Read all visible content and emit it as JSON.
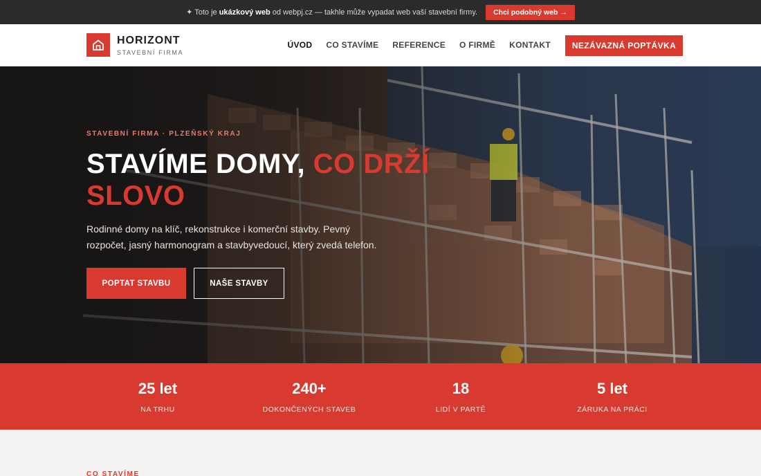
{
  "topbar": {
    "prefix": "✦ Toto je",
    "bold": "ukázkový web",
    "suffix": "od webpj.cz — takhle může vypadat web vaší stavební firmy.",
    "cta": "Chci podobný web →"
  },
  "brand": {
    "name": "HORIZONT",
    "tagline": "STAVEBNÍ FIRMA",
    "accent_color": "#d93a30"
  },
  "nav": {
    "items": [
      {
        "label": "ÚVOD",
        "active": true
      },
      {
        "label": "CO STAVÍME"
      },
      {
        "label": "REFERENCE"
      },
      {
        "label": "O FIRMĚ"
      },
      {
        "label": "KONTAKT"
      }
    ],
    "cta": "NEZÁVAZNÁ POPTÁVKA"
  },
  "hero": {
    "eyebrow": "STAVEBNÍ FIRMA · PLZEŇSKÝ KRAJ",
    "title_main": "STAVÍME DOMY,",
    "title_accent": "CO DRŽÍ SLOVO",
    "lead": "Rodinné domy na klíč, rekonstrukce i komerční stavby. Pevný rozpočet, jasný harmonogram a stavbyvedoucí, který zvedá telefon.",
    "primary_button": "POPTAT STAVBU",
    "secondary_button": "NAŠE STAVBY"
  },
  "stats": [
    {
      "value": "25 let",
      "label": "NA TRHU"
    },
    {
      "value": "240+",
      "label": "DOKONČENÝCH STAVEB"
    },
    {
      "value": "18",
      "label": "LIDÍ V PARTĚ"
    },
    {
      "value": "5 let",
      "label": "ZÁRUKA NA PRÁCI"
    }
  ],
  "next_section": {
    "label": "CO STAVÍME"
  }
}
